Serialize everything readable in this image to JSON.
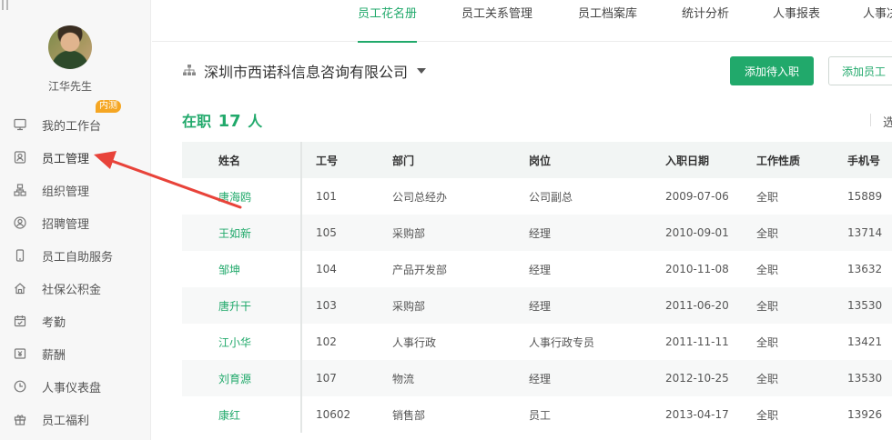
{
  "sidebar": {
    "user_name": "江华先生",
    "items": [
      {
        "label": "我的工作台",
        "icon": "monitor-icon"
      },
      {
        "label": "员工管理",
        "icon": "user-card-icon"
      },
      {
        "label": "组织管理",
        "icon": "org-chart-icon"
      },
      {
        "label": "招聘管理",
        "icon": "recruit-icon",
        "badge": "内测"
      },
      {
        "label": "员工自助服务",
        "icon": "phone-icon"
      },
      {
        "label": "社保公积金",
        "icon": "house-icon"
      },
      {
        "label": "考勤",
        "icon": "calendar-icon"
      },
      {
        "label": "薪酬",
        "icon": "salary-icon"
      },
      {
        "label": "人事仪表盘",
        "icon": "clock-dial-icon"
      },
      {
        "label": "员工福利",
        "icon": "gift-icon"
      }
    ]
  },
  "tabs": [
    "员工花名册",
    "员工关系管理",
    "员工档案库",
    "统计分析",
    "人事报表",
    "人事决"
  ],
  "company": {
    "name": "深圳市西诺科信息咨询有限公司"
  },
  "actions": {
    "add_pending": "添加待入职",
    "add_employee": "添加员工"
  },
  "summary": {
    "prefix": "在职",
    "count": "17",
    "suffix": "人",
    "tail": "选"
  },
  "table": {
    "headers": [
      "姓名",
      "工号",
      "部门",
      "岗位",
      "入职日期",
      "工作性质",
      "手机号"
    ],
    "rows": [
      [
        "唐海鸥",
        "101",
        "公司总经办",
        "公司副总",
        "2009-07-06",
        "全职",
        "15889"
      ],
      [
        "王如新",
        "105",
        "采购部",
        "经理",
        "2010-09-01",
        "全职",
        "13714"
      ],
      [
        "邹坤",
        "104",
        "产品开发部",
        "经理",
        "2010-11-08",
        "全职",
        "13632"
      ],
      [
        "唐升干",
        "103",
        "采购部",
        "经理",
        "2011-06-20",
        "全职",
        "13530"
      ],
      [
        "江小华",
        "102",
        "人事行政",
        "人事行政专员",
        "2011-11-11",
        "全职",
        "13421"
      ],
      [
        "刘育源",
        "107",
        "物流",
        "经理",
        "2012-10-25",
        "全职",
        "13530"
      ],
      [
        "康红",
        "10602",
        "销售部",
        "员工",
        "2013-04-17",
        "全职",
        "13926"
      ]
    ]
  },
  "colors": {
    "accent": "#21a96b",
    "badge": "#f5a623",
    "annotation_arrow": "#e8433a"
  }
}
